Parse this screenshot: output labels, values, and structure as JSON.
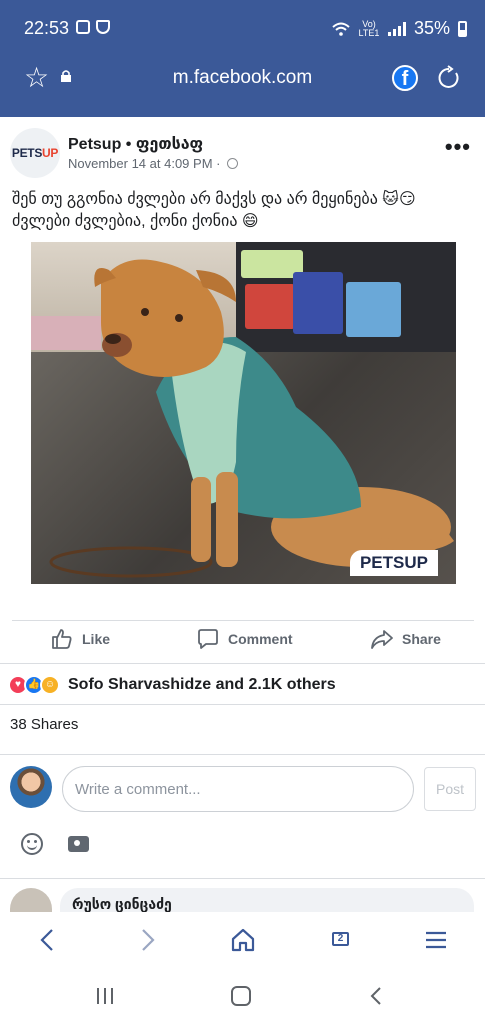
{
  "status_bar": {
    "time": "22:53",
    "network": "Vo) LTE1",
    "battery": "35%"
  },
  "browser": {
    "url": "m.facebook.com"
  },
  "post": {
    "page_name": "Petsup • ფეთსაფ",
    "timestamp": "November 14 at 4:09 PM ·",
    "text": "შენ თუ გგონია ძვლები არ მაქვს და არ მეყინება 🐱😏 ძვლები ძვლებია, ქონი ქონია 😄",
    "logo_text": "PETSUP",
    "photo_watermark": "PETSUP"
  },
  "actions": {
    "like": "Like",
    "comment": "Comment",
    "share": "Share"
  },
  "reactions": {
    "summary": "Sofo Sharvashidze and 2.1K others",
    "types": [
      "love",
      "like",
      "haha"
    ]
  },
  "shares": "38 Shares",
  "composer": {
    "placeholder": "Write a comment...",
    "post_label": "Post"
  },
  "next_comment": {
    "author": "რუსო ცინცაძე"
  },
  "colors": {
    "brand": "#3b5998",
    "fb_blue": "#1877f2",
    "text_secondary": "#606770"
  },
  "icons": [
    "star-icon",
    "lock-icon",
    "facebook-icon",
    "reload-icon",
    "globe-icon",
    "more-icon",
    "like-icon",
    "comment-icon",
    "share-icon",
    "emoji-icon",
    "camera-icon",
    "back-icon",
    "forward-icon",
    "home-icon",
    "tabs-icon",
    "menu-icon"
  ],
  "bottom_nav": {
    "tab_count": "2"
  }
}
